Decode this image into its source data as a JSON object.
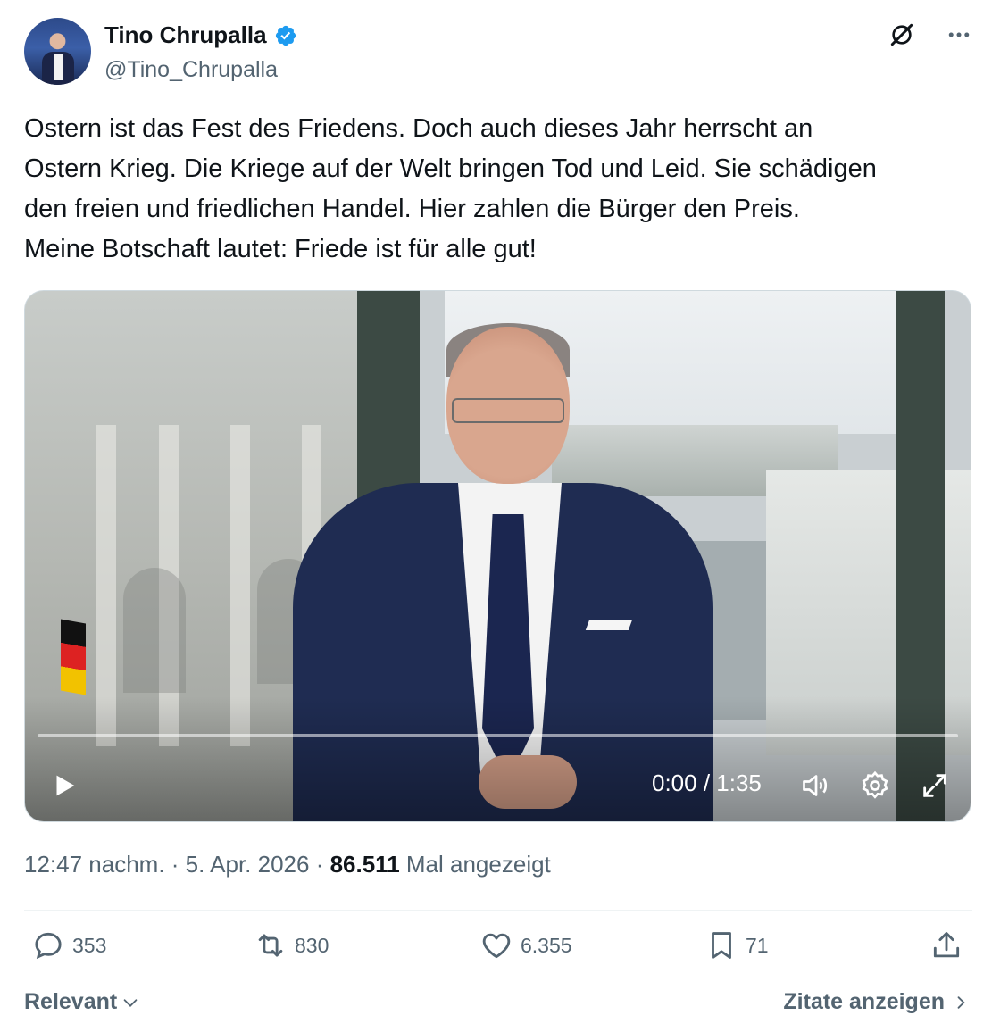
{
  "author": {
    "name": "Tino Chrupalla",
    "handle": "@Tino_Chrupalla",
    "verified_icon": "verified-badge-icon",
    "verified_color": "#1d9bf0"
  },
  "top_icons": [
    "grok-icon",
    "more-icon"
  ],
  "tweet": {
    "lines": [
      "Ostern ist das Fest des Friedens. Doch auch dieses Jahr herrscht an",
      "Ostern Krieg. Die Kriege auf der Welt bringen Tod und Leid. Sie schädigen",
      "den freien und friedlichen Handel. Hier zahlen die Bürger den Preis.",
      "Meine Botschaft lautet: Friede ist für alle gut!"
    ]
  },
  "video": {
    "time": "0:00 / 1:35",
    "progress": 0,
    "controls": [
      "play-icon",
      "volume-icon",
      "settings-icon",
      "fullscreen-icon"
    ]
  },
  "meta": {
    "time": "12:47 nachm.",
    "sep1": " · ",
    "date": "5. Apr. 2026",
    "sep2": " · ",
    "views": "86.511",
    "views_label": " Mal angezeigt"
  },
  "actions": {
    "replies": "353",
    "reposts": "830",
    "likes": "6.355",
    "bookmarks": "71"
  },
  "footer": {
    "sort_label": "Relevant",
    "quotes_label": "Zitate anzeigen"
  },
  "colors": {
    "text": "#0f1419",
    "secondary": "#536471",
    "accent": "#1d9bf0"
  }
}
